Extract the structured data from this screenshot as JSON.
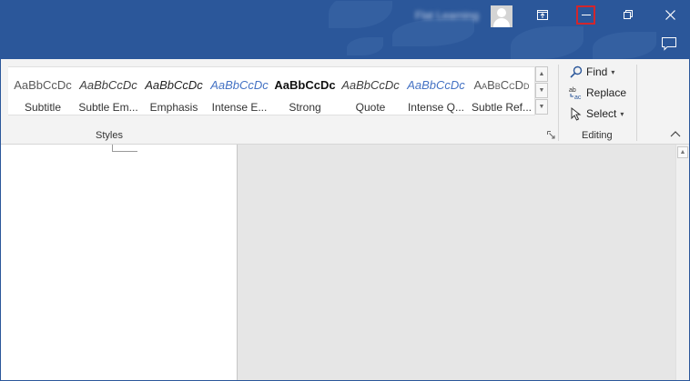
{
  "titlebar": {
    "user_name": "Flat Learning",
    "buttons": {
      "ribbon_display": "ribbon-display-options-icon",
      "minimize": "minimize-icon",
      "restore": "restore-icon",
      "close": "close-icon"
    },
    "highlight_color": "#d2262c",
    "background_color": "#2b579a"
  },
  "ribbon": {
    "styles_group": {
      "label": "Styles",
      "items": [
        {
          "sample": "AaBbCcDc",
          "name": "Subtitle"
        },
        {
          "sample": "AaBbCcDc",
          "name": "Subtle Em..."
        },
        {
          "sample": "AaBbCcDc",
          "name": "Emphasis"
        },
        {
          "sample": "AaBbCcDc",
          "name": "Intense E..."
        },
        {
          "sample": "AaBbCcDc",
          "name": "Strong"
        },
        {
          "sample": "AaBbCcDc",
          "name": "Quote"
        },
        {
          "sample": "AaBbCcDc",
          "name": "Intense Q..."
        },
        {
          "sample": "AaBbCcDd",
          "name": "Subtle Ref..."
        }
      ]
    },
    "editing_group": {
      "label": "Editing",
      "find": "Find",
      "replace": "Replace",
      "select": "Select"
    }
  }
}
